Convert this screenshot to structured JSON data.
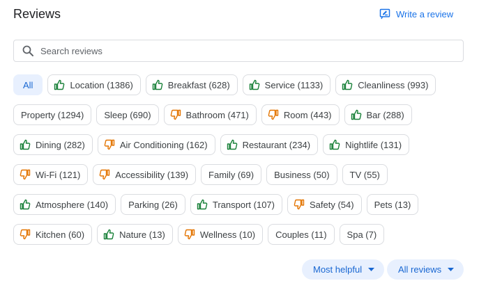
{
  "header": {
    "title": "Reviews",
    "write_review_label": "Write a review"
  },
  "search": {
    "placeholder": "Search reviews"
  },
  "chips": [
    {
      "label": "All",
      "sentiment": "none",
      "selected": true
    },
    {
      "label": "Location (1386)",
      "sentiment": "positive"
    },
    {
      "label": "Breakfast (628)",
      "sentiment": "positive"
    },
    {
      "label": "Service (1133)",
      "sentiment": "positive"
    },
    {
      "label": "Cleanliness (993)",
      "sentiment": "positive"
    },
    {
      "label": "Property (1294)",
      "sentiment": "none"
    },
    {
      "label": "Sleep (690)",
      "sentiment": "none"
    },
    {
      "label": "Bathroom (471)",
      "sentiment": "negative"
    },
    {
      "label": "Room (443)",
      "sentiment": "negative"
    },
    {
      "label": "Bar (288)",
      "sentiment": "positive"
    },
    {
      "label": "Dining (282)",
      "sentiment": "positive"
    },
    {
      "label": "Air Conditioning (162)",
      "sentiment": "negative"
    },
    {
      "label": "Restaurant (234)",
      "sentiment": "positive"
    },
    {
      "label": "Nightlife (131)",
      "sentiment": "positive"
    },
    {
      "label": "Wi-Fi (121)",
      "sentiment": "negative"
    },
    {
      "label": "Accessibility (139)",
      "sentiment": "negative"
    },
    {
      "label": "Family (69)",
      "sentiment": "none"
    },
    {
      "label": "Business (50)",
      "sentiment": "none"
    },
    {
      "label": "TV (55)",
      "sentiment": "none"
    },
    {
      "label": "Atmosphere (140)",
      "sentiment": "positive"
    },
    {
      "label": "Parking (26)",
      "sentiment": "none"
    },
    {
      "label": "Transport (107)",
      "sentiment": "positive"
    },
    {
      "label": "Safety (54)",
      "sentiment": "negative"
    },
    {
      "label": "Pets (13)",
      "sentiment": "none"
    },
    {
      "label": "Kitchen (60)",
      "sentiment": "negative"
    },
    {
      "label": "Nature (13)",
      "sentiment": "positive"
    },
    {
      "label": "Wellness (10)",
      "sentiment": "negative"
    },
    {
      "label": "Couples (11)",
      "sentiment": "none"
    },
    {
      "label": "Spa (7)",
      "sentiment": "none"
    }
  ],
  "sort": {
    "most_helpful_label": "Most helpful",
    "all_reviews_label": "All reviews"
  },
  "icons": {
    "write": "rate-review-icon",
    "search": "search-icon",
    "positive": "thumb-up-icon",
    "negative": "thumb-down-icon",
    "caret": "caret-down-icon"
  },
  "colors": {
    "accent": "#1a73e8",
    "positive": "#188038",
    "negative": "#e37400",
    "chip_selected_bg": "#e8f0fe"
  }
}
